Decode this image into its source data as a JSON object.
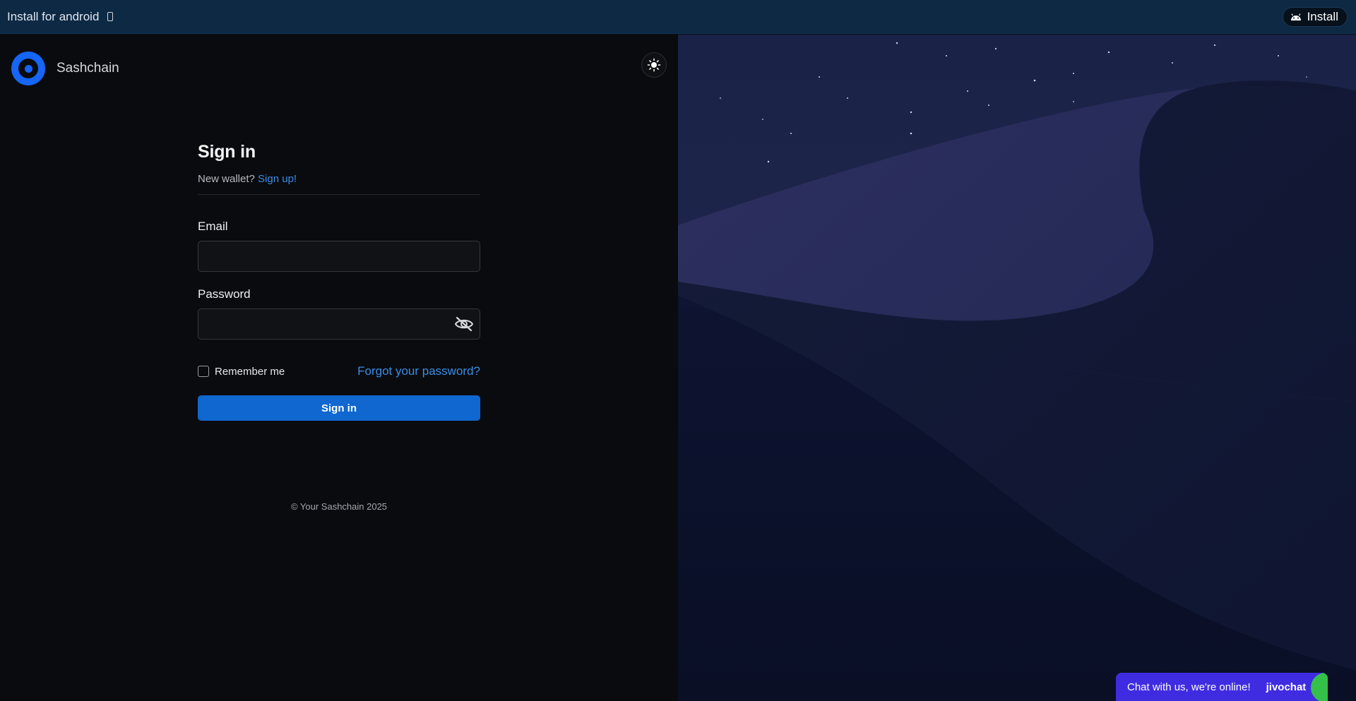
{
  "banner": {
    "text": "Install for android",
    "install_label": "Install"
  },
  "brand": {
    "name": "Sashchain"
  },
  "signin": {
    "title": "Sign in",
    "subtitle_prefix": "New wallet?",
    "signup_link": "Sign up!",
    "email_label": "Email",
    "email_value": "",
    "password_label": "Password",
    "password_value": "",
    "remember_label": "Remember me",
    "forgot_link": "Forgot your password?",
    "button_label": "Sign in"
  },
  "footer": {
    "copyright": "© Your Sashchain 2025"
  },
  "chat": {
    "text": "Chat with us, we're online!",
    "brand": "jivochat"
  },
  "colors": {
    "banner_bg": "#0d2944",
    "panel_bg": "#0a0b0e",
    "accent": "#1665f5",
    "link": "#3a8ee6",
    "primary_button": "#0f67cf",
    "chat_bg": "#3f2ce0"
  },
  "icons": [
    "phone-icon",
    "android-icon",
    "sun-icon",
    "eye-off-icon"
  ]
}
